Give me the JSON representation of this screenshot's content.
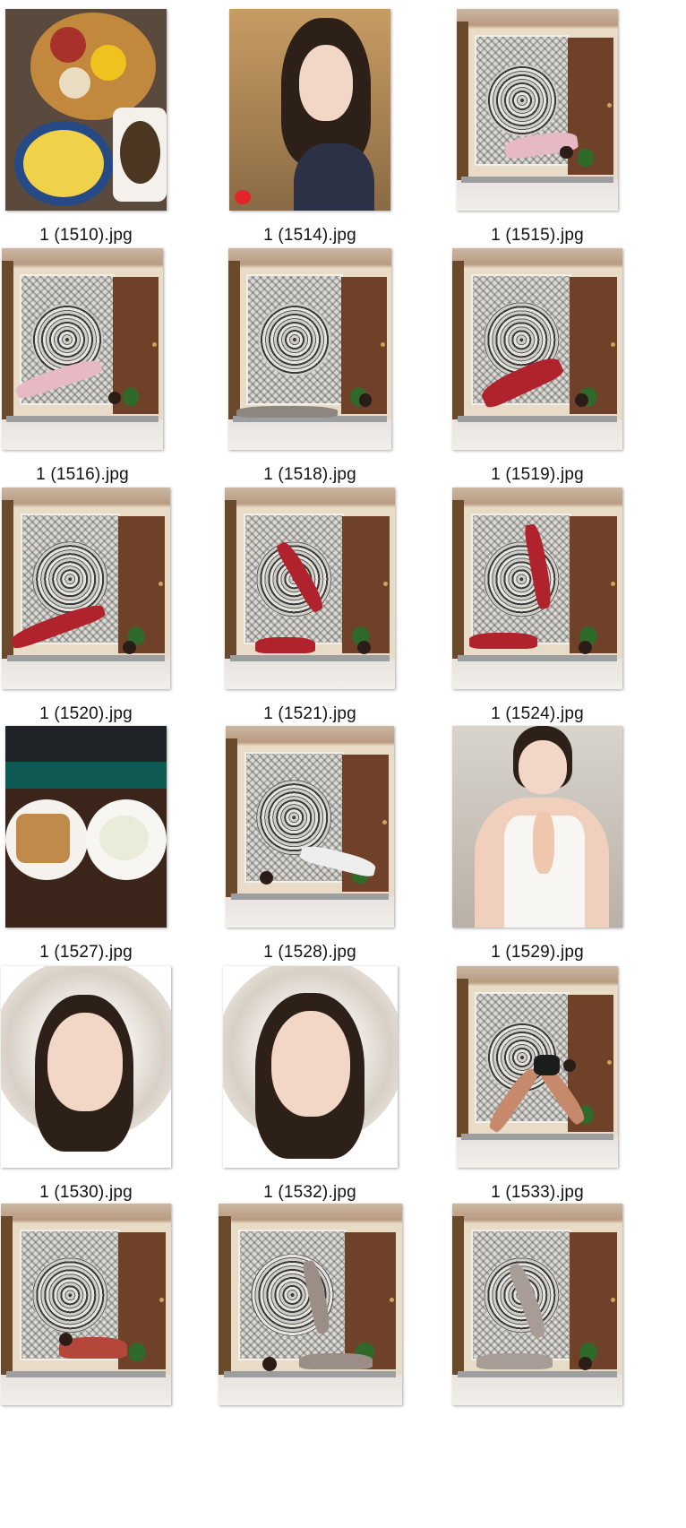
{
  "files": [
    {
      "name": "1 (1510).jpg",
      "kind": "food"
    },
    {
      "name": "1 (1514).jpg",
      "kind": "portrait"
    },
    {
      "name": "1 (1515).jpg",
      "kind": "yoga",
      "outfit": "#e7b9c4"
    },
    {
      "name": "1 (1516).jpg",
      "kind": "yoga",
      "outfit": "#e7b9c4"
    },
    {
      "name": "1 (1518).jpg",
      "kind": "yoga",
      "outfit": "#8d8580"
    },
    {
      "name": "1 (1519).jpg",
      "kind": "yoga",
      "outfit": "#b0232c"
    },
    {
      "name": "1 (1520).jpg",
      "kind": "yoga",
      "outfit": "#b0232c"
    },
    {
      "name": "1 (1521).jpg",
      "kind": "yoga",
      "outfit": "#b0232c"
    },
    {
      "name": "1 (1524).jpg",
      "kind": "yoga",
      "outfit": "#b0232c"
    },
    {
      "name": "1 (1527).jpg",
      "kind": "snack"
    },
    {
      "name": "1 (1528).jpg",
      "kind": "yoga",
      "outfit": "#eeeeee"
    },
    {
      "name": "1 (1529).jpg",
      "kind": "closeup"
    },
    {
      "name": "1 (1530).jpg",
      "kind": "hood"
    },
    {
      "name": "1 (1532).jpg",
      "kind": "hood"
    },
    {
      "name": "1 (1533).jpg",
      "kind": "yoga",
      "outfit": "#c7896c"
    },
    {
      "name": "",
      "kind": "yoga",
      "outfit": "#b5463a"
    },
    {
      "name": "",
      "kind": "yoga",
      "outfit": "#9a8e86"
    },
    {
      "name": "",
      "kind": "yoga",
      "outfit": "#a89d96"
    }
  ]
}
